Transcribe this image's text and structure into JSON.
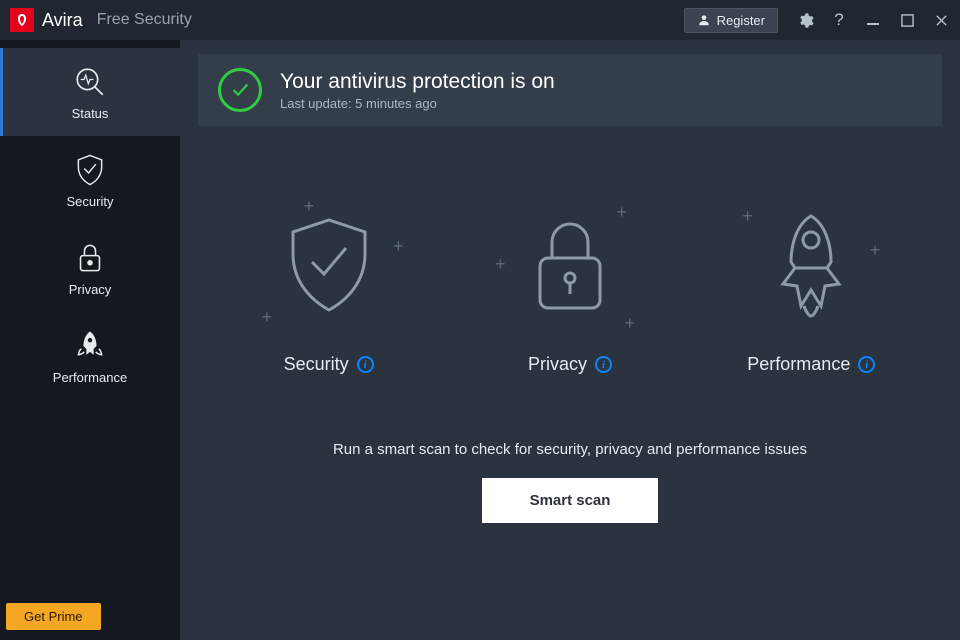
{
  "titlebar": {
    "brand": "Avira",
    "product": "Free Security",
    "register_label": "Register"
  },
  "sidebar": {
    "items": [
      {
        "label": "Status"
      },
      {
        "label": "Security"
      },
      {
        "label": "Privacy"
      },
      {
        "label": "Performance"
      }
    ],
    "get_prime_label": "Get Prime"
  },
  "status": {
    "headline": "Your antivirus protection is on",
    "subline": "Last update: 5 minutes ago"
  },
  "cards": {
    "security_label": "Security",
    "privacy_label": "Privacy",
    "performance_label": "Performance"
  },
  "scan": {
    "hint": "Run a smart scan to check for security, privacy and performance issues",
    "button_label": "Smart scan"
  },
  "colors": {
    "accent": "#e3001b",
    "ok": "#2ecc40",
    "info": "#0a84ff",
    "prime": "#f5a623"
  }
}
